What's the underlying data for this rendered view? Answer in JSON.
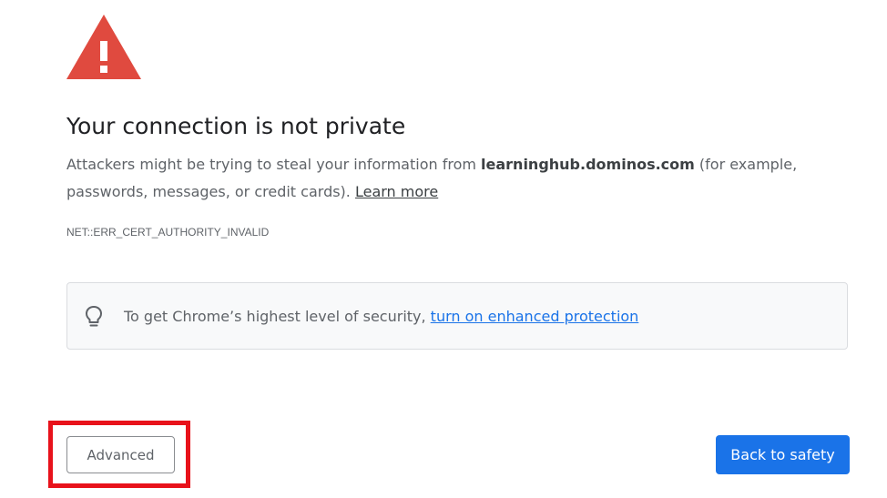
{
  "icons": {
    "warning": "warning-triangle-icon",
    "bulb": "lightbulb-icon"
  },
  "colors": {
    "warning_red": "#e04a3f",
    "link_blue": "#1a73e8",
    "primary_button": "#1a73e8",
    "highlight_red": "#e8121b"
  },
  "interstitial": {
    "title": "Your connection is not private",
    "description_prefix": "Attackers might be trying to steal your information from ",
    "host": "learninghub.dominos.com",
    "description_suffix": " (for example, passwords, messages, or credit cards). ",
    "learn_more": "Learn more",
    "error_code": "NET::ERR_CERT_AUTHORITY_INVALID"
  },
  "enhanced_protection": {
    "text": "To get Chrome’s highest level of security, ",
    "link": "turn on enhanced protection"
  },
  "buttons": {
    "advanced": "Advanced",
    "back_to_safety": "Back to safety"
  }
}
